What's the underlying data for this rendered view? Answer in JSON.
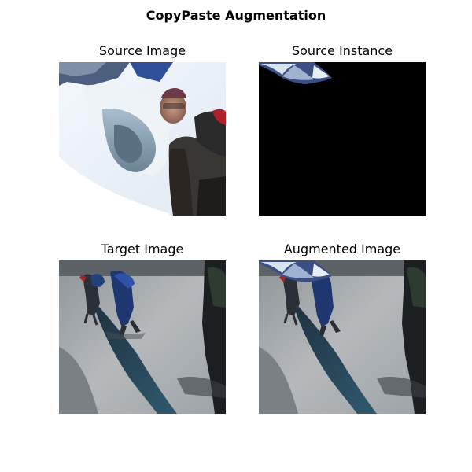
{
  "figure": {
    "title": "CopyPaste Augmentation"
  },
  "panels": [
    {
      "title": "Source Image"
    },
    {
      "title": "Source Instance"
    },
    {
      "title": "Target Image"
    },
    {
      "title": "Augmented Image"
    }
  ]
}
